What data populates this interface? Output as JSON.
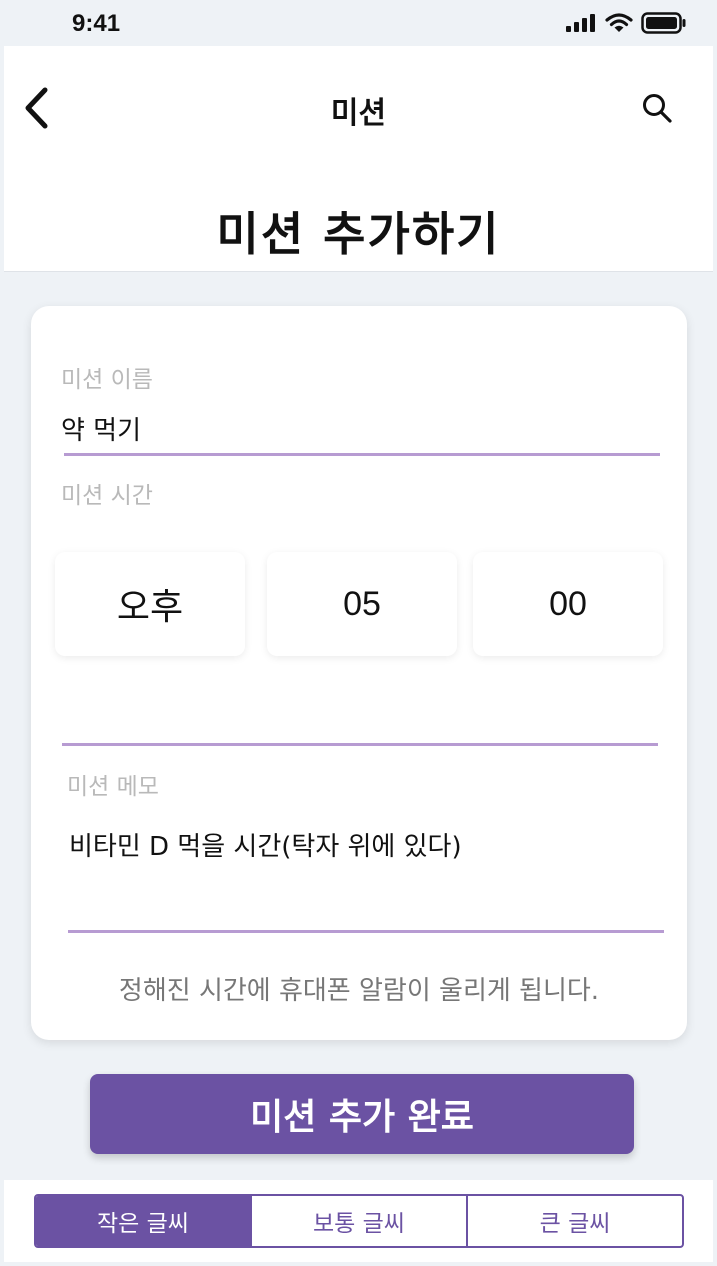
{
  "status_bar": {
    "time": "9:41"
  },
  "header": {
    "title": "미션",
    "page_title": "미션 추가하기"
  },
  "form": {
    "name_label": "미션 이름",
    "name_value": "약 먹기",
    "time_label": "미션 시간",
    "time": {
      "ampm": "오후",
      "hour": "05",
      "minute": "00"
    },
    "memo_label": "미션 메모",
    "memo_value": "비타민 D 먹을 시간(탁자 위에 있다)",
    "notice": "정해진 시간에 휴대폰 알람이 울리게 됩니다."
  },
  "submit_label": "미션 추가 완료",
  "font_size_options": [
    {
      "label": "작은 글씨",
      "active": true
    },
    {
      "label": "보통 글씨",
      "active": false
    },
    {
      "label": "큰 글씨",
      "active": false
    }
  ],
  "colors": {
    "accent": "#6b52a3",
    "underline": "#b79bd2",
    "background": "#eef2f6"
  },
  "icons": {
    "back": "chevron-left-icon",
    "search": "search-icon"
  }
}
